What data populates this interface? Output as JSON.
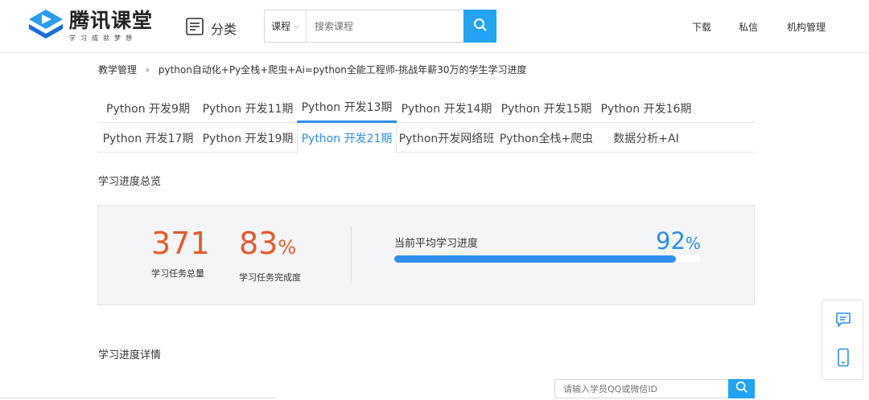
{
  "header": {
    "logo_title": "腾讯课堂",
    "logo_sub": "学习成就梦想",
    "category_label": "分类",
    "search_type": "课程",
    "search_placeholder": "搜索课程",
    "nav": [
      "下载",
      "私信",
      "机构管理"
    ]
  },
  "breadcrumb": {
    "root": "教学管理",
    "current": "python自动化+Py全栈+爬虫+Ai=python全能工程师-挑战年薪30万的学生学习进度"
  },
  "tabs": {
    "row1": [
      "Python 开发9期",
      "Python 开发11期",
      "Python 开发13期",
      "Python 开发14期",
      "Python 开发15期",
      "Python 开发16期"
    ],
    "row2": [
      "Python 开发17期",
      "Python 开发19期",
      "Python 开发21期",
      "Python开发网络班",
      "Python全栈+爬虫",
      "数据分析+AI"
    ],
    "active_label": "Python 开发21期"
  },
  "overview": {
    "title": "学习进度总览",
    "total_tasks": "371",
    "total_tasks_label": "学习任务总量",
    "completion": "83",
    "completion_unit": "%",
    "completion_label": "学习任务完成度",
    "avg_label": "当前平均学习进度",
    "avg_value": "92",
    "avg_unit": "%",
    "avg_progress": 0.92
  },
  "details": {
    "title": "学习进度详情",
    "search_placeholder": "请输入学员QQ或微信ID"
  },
  "colors": {
    "accent": "#2e8ded",
    "search_blue": "#23a3f3",
    "number_orange": "#e75a2d"
  }
}
